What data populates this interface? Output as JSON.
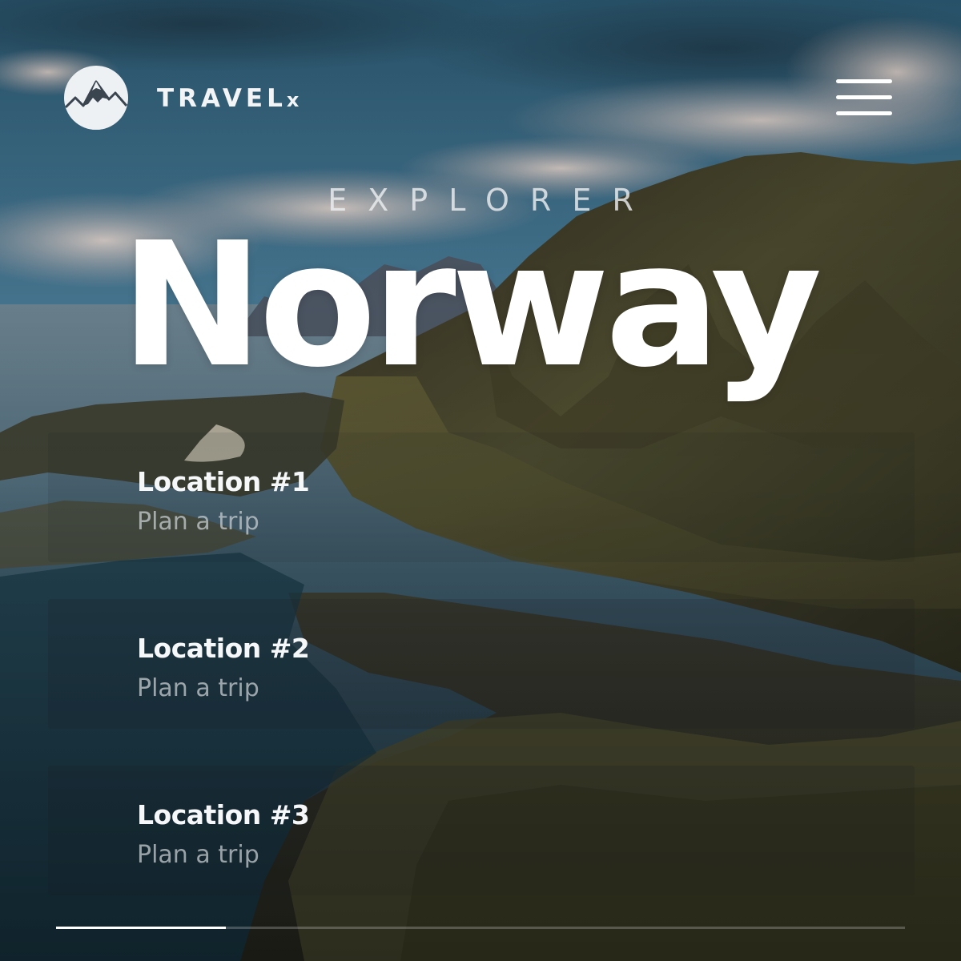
{
  "header": {
    "brand_main": "TRAVEL",
    "brand_suffix": "x",
    "logo_icon": "mountain-logo-icon",
    "menu_icon": "hamburger-menu-icon"
  },
  "hero": {
    "eyebrow": "EXPLORER",
    "title": "Norway"
  },
  "locations": [
    {
      "title": "Location #1",
      "action": "Plan a trip"
    },
    {
      "title": "Location #2",
      "action": "Plan a trip"
    },
    {
      "title": "Location #3",
      "action": "Plan a trip"
    }
  ],
  "carousel": {
    "progress": 0.2
  },
  "colors": {
    "text": "#ffffff",
    "subtext": "#cdd2d6",
    "logo_bg": "#eef1f3",
    "sky": "#3e6f8c",
    "mountain": "#4a4a2c"
  }
}
